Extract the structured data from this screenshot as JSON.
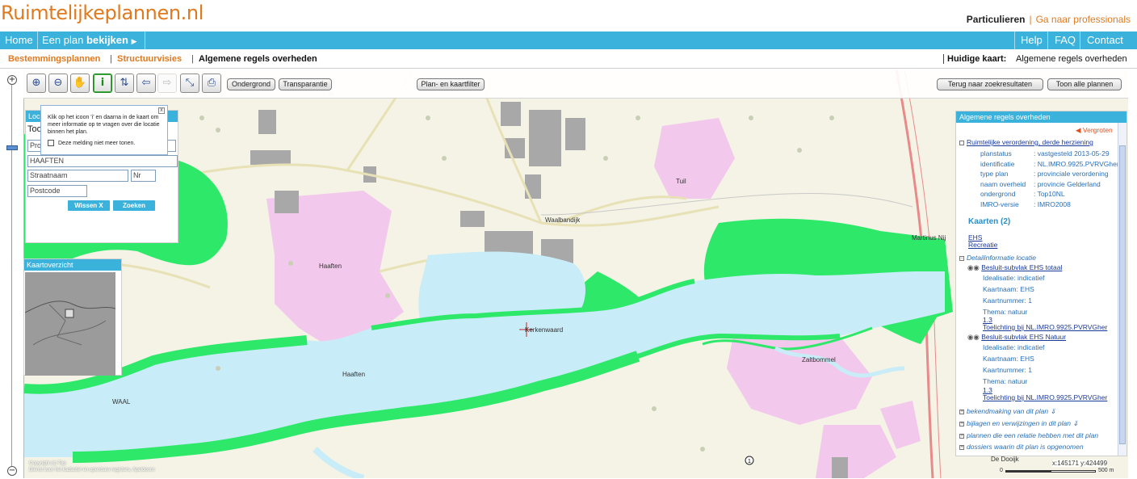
{
  "header": {
    "logo": "Ruimtelijkeplannen.nl",
    "particulieren": "Particulieren",
    "separator": "|",
    "professionals": "Ga naar professionals"
  },
  "nav": {
    "home": "Home",
    "plan_prefix": "Een plan ",
    "plan_bold": "bekijken",
    "help": "Help",
    "faq": "FAQ",
    "contact": "Contact"
  },
  "subnav": {
    "tab1": "Bestemmingsplannen",
    "sep1": "|",
    "tab2": "Structuurvisies",
    "sep2": "|",
    "tab3": "Algemene regels overheden",
    "current_label": "Huidige kaart:",
    "current_value": "Algemene regels overheden"
  },
  "toolbar": {
    "zoom_in_icon": "zoom-in-icon",
    "ondergrond": "Ondergrond",
    "transparantie": "Transparantie",
    "filter": "Plan- en kaartfilter",
    "back_results": "Terug naar zoekresultaten",
    "show_all": "Toon alle plannen"
  },
  "tooltip": {
    "text": "Klik op het icoon 'i' en daarna in de kaart om meer informatie op te vragen over die locatie binnen het plan.",
    "checkbox_label": "Deze melding niet meer tonen.",
    "close": "x"
  },
  "location_panel": {
    "header": "Loc",
    "label": "Too",
    "province_placeholder": "Pro",
    "place_value": "HAAFTEN",
    "street_placeholder": "Straatnaam",
    "number_placeholder": "Nr",
    "postcode_placeholder": "Postcode",
    "clear_button": "Wissen X",
    "search_button": "Zoeken"
  },
  "overview": {
    "header": "Kaartoverzicht"
  },
  "map_labels": {
    "tuil": "Tuil",
    "waalbandijk": "Waalbandijk",
    "haaften_north": "Haaften",
    "haaften_south": "Haaften",
    "kerkenwaard": "Kerkenwaard",
    "zaltbommel": "Zaltbommel",
    "waal": "WAAL",
    "martinus": "Martinus Nij",
    "de_dooijk": "De Dooijk"
  },
  "info_panel": {
    "header": "Algemene regels overheden",
    "enlarge": "Vergroten",
    "plan_title": "Ruimtelijke verordening, derde herziening",
    "fields": [
      {
        "key": "planstatus",
        "value": ": vastgesteld 2013-05-29"
      },
      {
        "key": "identificatie",
        "value": ": NL.IMRO.9925.PVRVGher"
      },
      {
        "key": "type plan",
        "value": ": provinciale verordening"
      },
      {
        "key": "naam overheid",
        "value": ": provincie Gelderland"
      },
      {
        "key": "ondergrond",
        "value": ": Top10NL"
      },
      {
        "key": "IMRO-versie",
        "value": ": IMRO2008"
      }
    ],
    "maps_heading": "Kaarten (2)",
    "map_link1": "EHS",
    "map_link2": "Recreatie",
    "detail_heading": "Detailinformatie locatie",
    "block1": {
      "title": "Besluit-subvlak EHS totaal",
      "idealisatie": "Idealisatie: indicatief",
      "kaartnaam": "Kaartnaam: EHS",
      "kaartnummer": "Kaartnummer: 1",
      "thema": "Thema: natuur",
      "ref": "1.3",
      "toelichting": "Toelichting bij NL.IMRO.9925.PVRVGher"
    },
    "block2": {
      "title": "Besluit-subvlak EHS Natuur",
      "idealisatie": "Idealisatie: indicatief",
      "kaartnaam": "Kaartnaam: EHS",
      "kaartnummer": "Kaartnummer: 1",
      "thema": "Thema: natuur",
      "ref": "1.3",
      "toelichting": "Toelichting bij NL.IMRO.9925.PVRVGher"
    },
    "more1": "bekendmaking van dit plan",
    "more2": "bijlagen en verwijzingen in dit plan",
    "more3": "plannen die een relatie hebben met dit plan",
    "more4": "dossiers waarin dit plan is opgenomen"
  },
  "status": {
    "coords": "x:145171 y:424499",
    "scale_zero": "0",
    "scale_max": "500 m",
    "copyright1": "Copyright (c) Top",
    "copyright2": "Dienst voor het kadaster en openbare registers, Apeldoorn"
  },
  "colors": {
    "brand_orange": "#e07a1f",
    "nav_blue": "#3bb2dc",
    "water": "#c8ecf8",
    "ehs_green": "#2ee86a",
    "urban_pink": "#f2c8ec"
  }
}
